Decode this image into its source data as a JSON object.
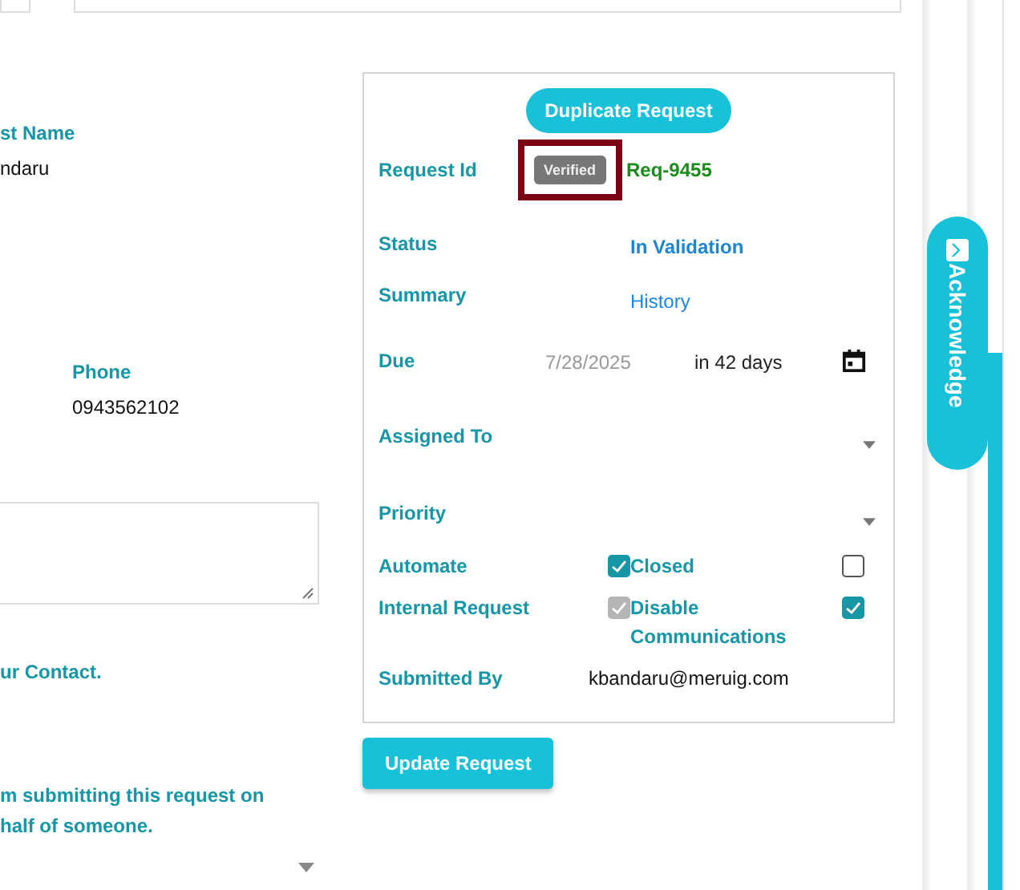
{
  "contact": {
    "name_label": "st Name",
    "name_value": "ndaru",
    "phone_label": "Phone",
    "phone_value": "0943562102",
    "contact_label": "ur Contact.",
    "behalf_label": "m submitting this request on\nhalf of someone."
  },
  "request_panel": {
    "duplicate_button": "Duplicate Request",
    "rows": [
      {
        "kind": "id",
        "label": "Request Id",
        "badge": "Verified",
        "value": "Req-9455"
      },
      {
        "kind": "status",
        "label": "Status",
        "value": "In Validation"
      },
      {
        "kind": "link",
        "label": "Summary",
        "value": "History"
      },
      {
        "kind": "date",
        "label": "Due",
        "value": "7/28/2025",
        "note": "in 42 days"
      },
      {
        "kind": "select",
        "label": "Assigned To"
      },
      {
        "kind": "select",
        "label": "Priority"
      },
      {
        "kind": "checks",
        "items": [
          {
            "label": "Automate",
            "checked": true,
            "disabled": false
          },
          {
            "label": "Closed",
            "checked": false,
            "disabled": false
          }
        ]
      },
      {
        "kind": "checks",
        "items": [
          {
            "label": "Internal Request",
            "checked": true,
            "disabled": true
          },
          {
            "label": "Disable Communications",
            "checked": true,
            "disabled": false
          }
        ]
      },
      {
        "kind": "text",
        "label": "Submitted By",
        "value": "kbandaru@meruig.com"
      }
    ]
  },
  "update_button": "Update Request",
  "acknowledge_tab": "Acknowledge"
}
